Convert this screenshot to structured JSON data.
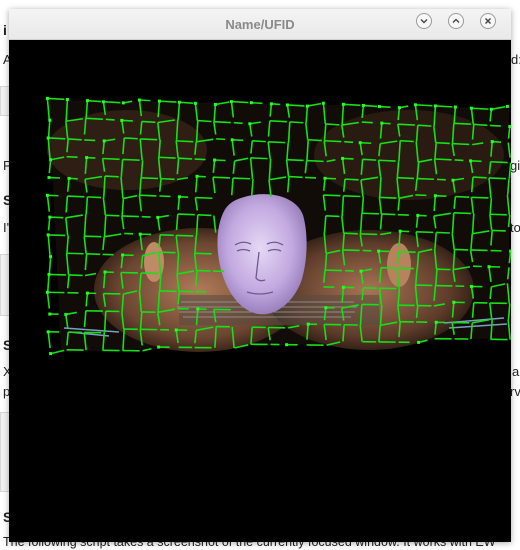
{
  "window": {
    "title": "Name/UFID",
    "buttons": [
      "minimize",
      "maximize",
      "close"
    ]
  },
  "background_page": {
    "lines": [
      {
        "text": "i",
        "style": "bold"
      },
      {
        "text": "A",
        "style": "normal"
      },
      {
        "text": "d:",
        "style": "normal"
      },
      {
        "text": "P",
        "style": "normal"
      },
      {
        "text": "gic",
        "style": "normal"
      },
      {
        "text": "S",
        "style": "bold"
      },
      {
        "text": "I'",
        "style": "normal"
      },
      {
        "text": "to",
        "style": "normal"
      },
      {
        "text": "S",
        "style": "bold"
      },
      {
        "text": "X",
        "style": "normal"
      },
      {
        "text": "a",
        "style": "normal"
      },
      {
        "text": "p",
        "style": "normal"
      },
      {
        "text": "rv",
        "style": "normal"
      },
      {
        "text": "S",
        "style": "bold"
      }
    ],
    "footer_text": "The following script takes a screenshot of the currently focused window. It works with EW"
  },
  "scene": {
    "description_colors": {
      "mesh": "#00ff00",
      "face_model": "#c9b3e6",
      "background": "#000000",
      "skin": "#9a6a4e"
    }
  }
}
